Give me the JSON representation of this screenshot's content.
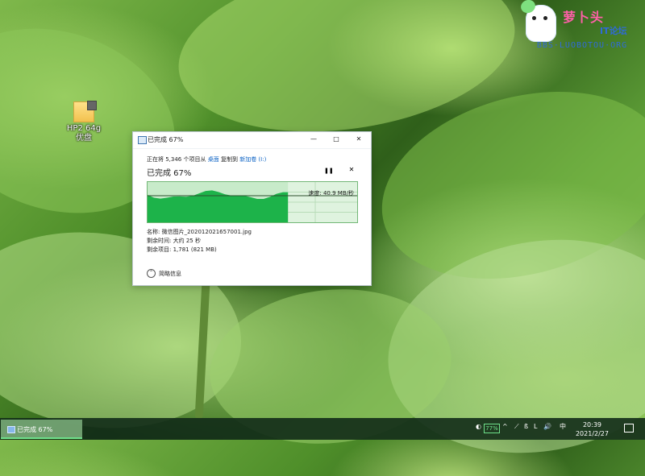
{
  "desktop": {
    "icon_label": "HP2 64g优盘",
    "watermark": {
      "title": "萝卜头",
      "subtitle": "IT论坛",
      "url": "BBS·LUOBOTOU·ORG"
    }
  },
  "dialog": {
    "title": "已完成 67%",
    "status_prefix": "正在将 5,346 个项目从",
    "source": "桌面",
    "middle": "复制到",
    "destination": "新加卷 (I:)",
    "headline": "已完成 67%",
    "speed": "速度: 40.9 MB/秒",
    "name_label": "名称:",
    "name_value": "微信图片_202012021657001.jpg",
    "time_left_label": "剩余时间:",
    "time_left_value": "大约 25 秒",
    "items_left_label": "剩余项目:",
    "items_left_value": "1,781 (821 MB)",
    "details_label": "简略信息",
    "progress": 0.67
  },
  "taskbar": {
    "task_label": "已完成 67%",
    "tray_percent": "77%",
    "input_method": "中",
    "time": "20:39",
    "date": "2021/2/27"
  }
}
